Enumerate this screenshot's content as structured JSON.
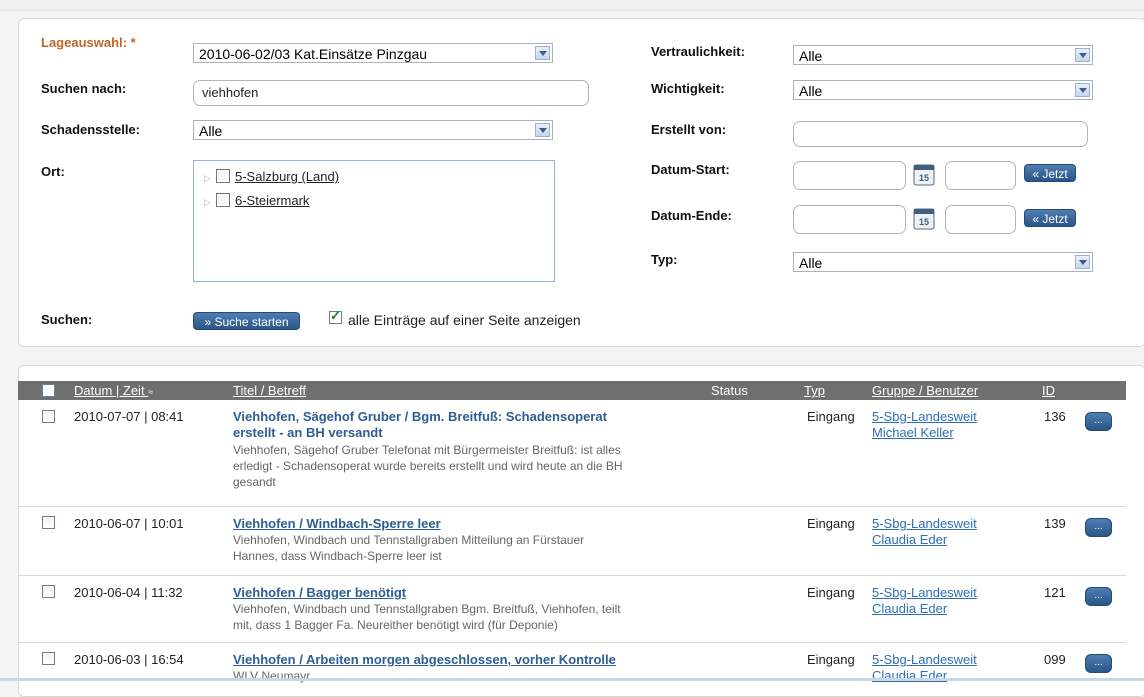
{
  "filters": {
    "lage_label": "Lageauswahl: *",
    "lage_value": "2010-06-02/03 Kat.Einsätze Pinzgau",
    "suchen_nach_label": "Suchen nach:",
    "suchen_nach_value": "viehhofen",
    "schadensstelle_label": "Schadensstelle:",
    "schadensstelle_value": "Alle",
    "ort_label": "Ort:",
    "ort_tree": [
      "5-Salzburg (Land)",
      "6-Steiermark"
    ],
    "suchen_label": "Suchen:",
    "search_button": "» Suche starten",
    "all_entries_label": "alle Einträge auf einer Seite anzeigen",
    "all_entries_checked": true,
    "vertraulichkeit_label": "Vertraulichkeit:",
    "vertraulichkeit_value": "Alle",
    "wichtigkeit_label": "Wichtigkeit:",
    "wichtigkeit_value": "Alle",
    "erstellt_von_label": "Erstellt von:",
    "erstellt_von_value": "",
    "datum_start_label": "Datum-Start:",
    "datum_ende_label": "Datum-Ende:",
    "jetzt_button": "« Jetzt",
    "calendar_day": "15",
    "typ_label": "Typ:",
    "typ_value": "Alle"
  },
  "table": {
    "headers": {
      "datum": "Datum | Zeit",
      "sort_indicator": "≈",
      "titel": "Titel / Betreff",
      "status": "Status",
      "typ": "Typ",
      "gruppe": "Gruppe / Benutzer",
      "id": "ID"
    },
    "more_label": "...",
    "rows": [
      {
        "datetime": "2010-07-07 | 08:41",
        "title_line1": "Viehhofen, Sägehof Gruber / Bgm. Breitfuß: Schadensoperat",
        "title_line2": "erstellt - an BH versandt",
        "desc_lines": [
          "Viehhofen, Sägehof Gruber Telefonat mit Bürgermeister Breitfuß: ist alles",
          "erledigt - Schadensoperat wurde bereits erstellt und wird heute an die BH",
          "gesandt"
        ],
        "typ": "Eingang",
        "group": "5-Sbg-Landesweit",
        "user": "Michael Keller",
        "id": "136"
      },
      {
        "datetime": "2010-06-07 | 10:01",
        "title_line1": "Viehhofen / Windbach-Sperre leer",
        "title_line2": "",
        "desc_lines": [
          "Viehhofen, Windbach und Tennstallgraben Mitteilung an Fürstauer",
          "Hannes, dass Windbach-Sperre leer ist"
        ],
        "typ": "Eingang",
        "group": "5-Sbg-Landesweit",
        "user": "Claudia Eder",
        "id": "139"
      },
      {
        "datetime": "2010-06-04 | 11:32",
        "title_line1": "Viehhofen / Bagger benötigt",
        "title_line2": "",
        "desc_lines": [
          "Viehhofen, Windbach und Tennstallgraben Bgm. Breitfuß, Viehhofen, teilt",
          "mit, dass 1 Bagger Fa. Neureither benötigt wird (für Deponie)"
        ],
        "typ": "Eingang",
        "group": "5-Sbg-Landesweit",
        "user": "Claudia Eder",
        "id": "121"
      },
      {
        "datetime": "2010-06-03 | 16:54",
        "title_line1": "Viehhofen / Arbeiten morgen abgeschlossen, vorher Kontrolle",
        "title_line2": "",
        "desc_lines": [
          "WLV Neumayr"
        ],
        "typ": "Eingang",
        "group": "5-Sbg-Landesweit",
        "user": "Claudia Eder",
        "id": "099"
      }
    ]
  }
}
